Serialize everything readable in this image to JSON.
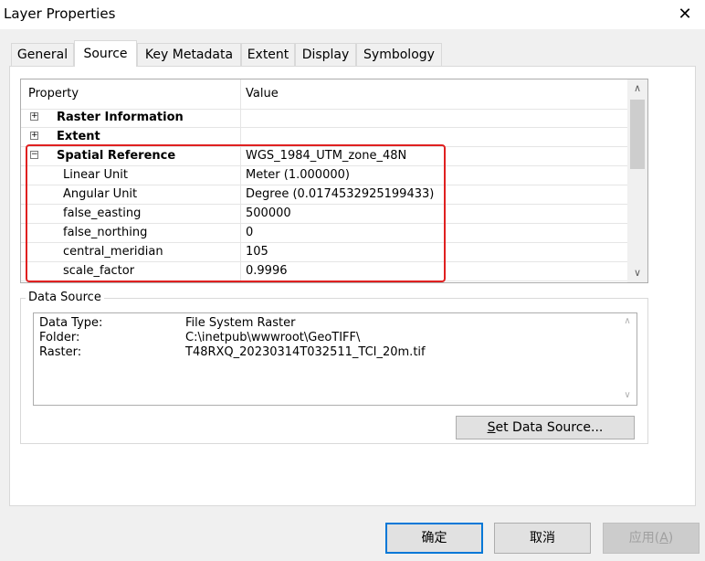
{
  "window": {
    "title": "Layer Properties",
    "close_glyph": "✕"
  },
  "tabs": [
    {
      "label": "General"
    },
    {
      "label": "Source"
    },
    {
      "label": "Key Metadata"
    },
    {
      "label": "Extent"
    },
    {
      "label": "Display"
    },
    {
      "label": "Symbology"
    }
  ],
  "active_tab": "Source",
  "grid": {
    "headers": {
      "property": "Property",
      "value": "Value"
    },
    "rows": [
      {
        "name": "Raster Information",
        "value": "",
        "expander": "+",
        "bold": true
      },
      {
        "name": "Extent",
        "value": "",
        "expander": "+",
        "bold": true
      },
      {
        "name": "Spatial Reference",
        "value": "WGS_1984_UTM_zone_48N",
        "expander": "−",
        "bold": true
      },
      {
        "name": "Linear Unit",
        "value": "Meter (1.000000)"
      },
      {
        "name": "Angular Unit",
        "value": "Degree (0.0174532925199433)"
      },
      {
        "name": "false_easting",
        "value": "500000"
      },
      {
        "name": "false_northing",
        "value": "0"
      },
      {
        "name": "central_meridian",
        "value": "105"
      },
      {
        "name": "scale_factor",
        "value": "0.9996"
      }
    ],
    "scroll_up": "∧",
    "scroll_down": "∨",
    "highlight_color": "#e02020"
  },
  "data_source": {
    "label": "Data Source",
    "lines": [
      {
        "key": "Data Type:",
        "value": "File System Raster"
      },
      {
        "key": "Folder:",
        "value": "C:\\inetpub\\wwwroot\\GeoTIFF\\"
      },
      {
        "key": "Raster:",
        "value": "T48RXQ_20230314T032511_TCI_20m.tif"
      }
    ],
    "set_button": {
      "mnemonic": "S",
      "rest": "et Data Source..."
    }
  },
  "buttons": {
    "ok": "确定",
    "cancel": "取消",
    "apply_prefix": "应用(",
    "apply_mnemonic": "A",
    "apply_suffix": ")"
  }
}
